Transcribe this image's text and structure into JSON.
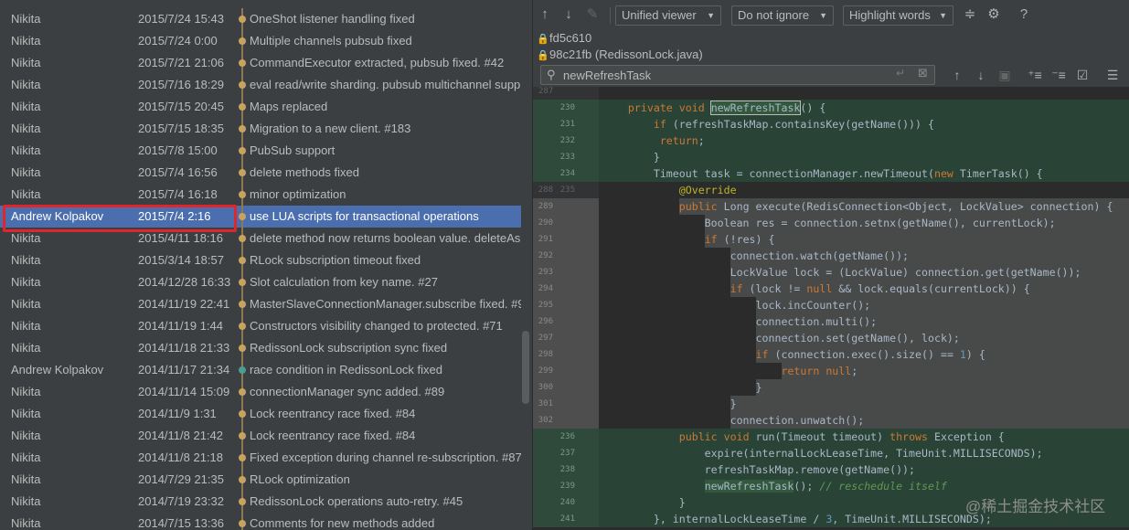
{
  "colors": {
    "accent_selected": "#4b6eaf",
    "highlight_box": "#e0262b",
    "added_bg": "#294436",
    "changed_bg": "#484a4a"
  },
  "log": {
    "commits": [
      {
        "author": "Nikita",
        "date": "2015/7/24 15:43",
        "subject": "OneShot listener handling fixed"
      },
      {
        "author": "Nikita",
        "date": "2015/7/24 0:00",
        "subject": "Multiple channels pubsub fixed"
      },
      {
        "author": "Nikita",
        "date": "2015/7/21 21:06",
        "subject": "CommandExecutor extracted, pubsub fixed. #42"
      },
      {
        "author": "Nikita",
        "date": "2015/7/16 18:29",
        "subject": "eval read/write sharding. pubsub multichannel supp"
      },
      {
        "author": "Nikita",
        "date": "2015/7/15 20:45",
        "subject": "Maps replaced"
      },
      {
        "author": "Nikita",
        "date": "2015/7/15 18:35",
        "subject": "Migration to a new client. #183"
      },
      {
        "author": "Nikita",
        "date": "2015/7/8 15:00",
        "subject": "PubSub support"
      },
      {
        "author": "Nikita",
        "date": "2015/7/4 16:56",
        "subject": "delete methods fixed"
      },
      {
        "author": "Nikita",
        "date": "2015/7/4 16:18",
        "subject": "minor optimization"
      },
      {
        "author": "Andrew Kolpakov",
        "date": "2015/7/4 2:16",
        "subject": "use LUA scripts for transactional operations"
      },
      {
        "author": "Nikita",
        "date": "2015/4/11 18:16",
        "subject": "delete method now returns boolean value. deleteAs"
      },
      {
        "author": "Nikita",
        "date": "2015/3/14 18:57",
        "subject": "RLock subscription timeout fixed"
      },
      {
        "author": "Nikita",
        "date": "2014/12/28 16:33",
        "subject": "Slot calculation from key name. #27"
      },
      {
        "author": "Nikita",
        "date": "2014/11/19 22:41",
        "subject": "MasterSlaveConnectionManager.subscribe fixed. #9"
      },
      {
        "author": "Nikita",
        "date": "2014/11/19 1:44",
        "subject": "Constructors visibility changed to protected. #71"
      },
      {
        "author": "Nikita",
        "date": "2014/11/18 21:33",
        "subject": "RedissonLock subscription sync fixed"
      },
      {
        "author": "Andrew Kolpakov",
        "date": "2014/11/17 21:34",
        "subject": "race condition in RedissonLock fixed"
      },
      {
        "author": "Nikita",
        "date": "2014/11/14 15:09",
        "subject": "connectionManager sync added. #89"
      },
      {
        "author": "Nikita",
        "date": "2014/11/9 1:31",
        "subject": "Lock reentrancy race fixed. #84"
      },
      {
        "author": "Nikita",
        "date": "2014/11/8 21:42",
        "subject": "Lock reentrancy race fixed. #84"
      },
      {
        "author": "Nikita",
        "date": "2014/11/8 21:18",
        "subject": "Fixed exception during channel re-subscription. #87"
      },
      {
        "author": "Nikita",
        "date": "2014/7/29 21:35",
        "subject": "RLock optimization"
      },
      {
        "author": "Nikita",
        "date": "2014/7/19 23:32",
        "subject": "RedissonLock operations auto-retry. #45"
      },
      {
        "author": "Nikita",
        "date": "2014/7/15 13:36",
        "subject": "Comments for new methods added"
      }
    ]
  },
  "diff": {
    "toolbar": {
      "viewer": "Unified viewer",
      "whitespace": "Do not ignore",
      "highlight": "Highlight words"
    },
    "files": [
      "fd5c610",
      "98c21fb (RedissonLock.java)"
    ],
    "search": {
      "value": "newRefreshTask"
    },
    "top_line_number": "287",
    "lines": [
      {
        "n1": "",
        "n2": "230",
        "t": "added",
        "code": "    private void newRefreshTask() {"
      },
      {
        "n1": "",
        "n2": "231",
        "t": "added",
        "code": "        if (refreshTaskMap.containsKey(getName())) {"
      },
      {
        "n1": "",
        "n2": "232",
        "t": "added",
        "code": "         return;"
      },
      {
        "n1": "",
        "n2": "233",
        "t": "added",
        "code": "        }"
      },
      {
        "n1": "",
        "n2": "234",
        "t": "added",
        "code": "        Timeout task = connectionManager.newTimeout(new TimerTask() {"
      },
      {
        "n1": "288",
        "n2": "235",
        "t": "context",
        "code": "            @Override"
      },
      {
        "n1": "289",
        "n2": "",
        "t": "removed",
        "code": "            public Long execute(RedisConnection<Object, LockValue> connection) {"
      },
      {
        "n1": "290",
        "n2": "",
        "t": "removed",
        "code": "                Boolean res = connection.setnx(getName(), currentLock);"
      },
      {
        "n1": "291",
        "n2": "",
        "t": "removed",
        "code": "                if (!res) {"
      },
      {
        "n1": "292",
        "n2": "",
        "t": "removed",
        "code": "                    connection.watch(getName());"
      },
      {
        "n1": "293",
        "n2": "",
        "t": "removed",
        "code": "                    LockValue lock = (LockValue) connection.get(getName());"
      },
      {
        "n1": "294",
        "n2": "",
        "t": "removed",
        "code": "                    if (lock != null && lock.equals(currentLock)) {"
      },
      {
        "n1": "295",
        "n2": "",
        "t": "removed",
        "code": "                        lock.incCounter();"
      },
      {
        "n1": "296",
        "n2": "",
        "t": "removed",
        "code": "                        connection.multi();"
      },
      {
        "n1": "297",
        "n2": "",
        "t": "removed",
        "code": "                        connection.set(getName(), lock);"
      },
      {
        "n1": "298",
        "n2": "",
        "t": "removed",
        "code": "                        if (connection.exec().size() == 1) {"
      },
      {
        "n1": "299",
        "n2": "",
        "t": "removed",
        "code": "                            return null;"
      },
      {
        "n1": "300",
        "n2": "",
        "t": "removed",
        "code": "                        }"
      },
      {
        "n1": "301",
        "n2": "",
        "t": "removed",
        "code": "                    }"
      },
      {
        "n1": "302",
        "n2": "",
        "t": "removed",
        "code": "                    connection.unwatch();"
      },
      {
        "n1": "",
        "n2": "236",
        "t": "added",
        "code": "            public void run(Timeout timeout) throws Exception {"
      },
      {
        "n1": "",
        "n2": "237",
        "t": "added",
        "code": "                expire(internalLockLeaseTime, TimeUnit.MILLISECONDS);"
      },
      {
        "n1": "",
        "n2": "238",
        "t": "added",
        "code": "                refreshTaskMap.remove(getName());"
      },
      {
        "n1": "",
        "n2": "239",
        "t": "added",
        "code": "                newRefreshTask(); // reschedule itself"
      },
      {
        "n1": "",
        "n2": "240",
        "t": "added",
        "code": "            }"
      },
      {
        "n1": "",
        "n2": "241",
        "t": "added",
        "code": "        }, internalLockLeaseTime / 3, TimeUnit.MILLISECONDS);"
      }
    ]
  },
  "watermark": "@稀土掘金技术社区"
}
